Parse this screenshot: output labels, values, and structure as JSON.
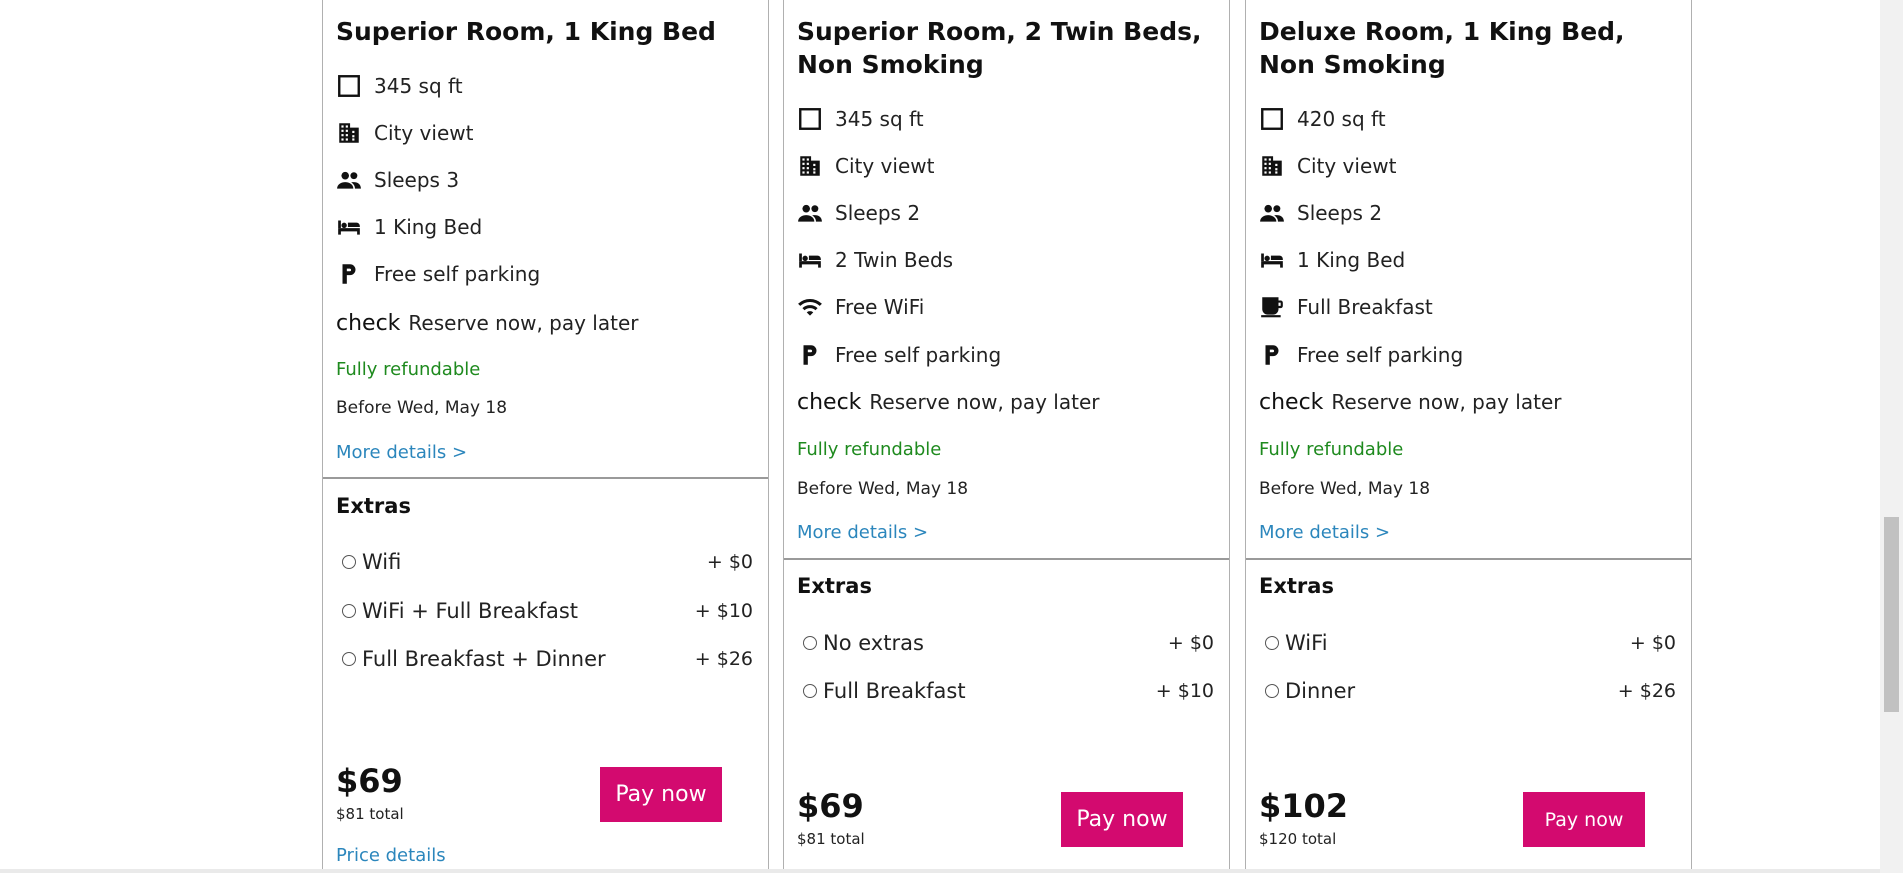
{
  "rooms": [
    {
      "title": "Superior Room, 1 King Bed",
      "features": [
        {
          "icon": "square-icon",
          "text": "345 sq ft"
        },
        {
          "icon": "building-icon",
          "text": "City viewt"
        },
        {
          "icon": "people-icon",
          "text": "Sleeps 3"
        },
        {
          "icon": "bed-icon",
          "text": "1 King Bed"
        },
        {
          "icon": "parking-icon",
          "text": "Free self parking"
        }
      ],
      "check_word": "check",
      "reserve": "Reserve now, pay later",
      "refundable": "Fully refundable",
      "before": "Before Wed, May 18",
      "more": "More details >",
      "extras_title": "Extras",
      "extras": [
        {
          "label": "Wifi",
          "price": "+ $0"
        },
        {
          "label": "WiFi + Full Breakfast",
          "price": "+ $10"
        },
        {
          "label": "Full Breakfast + Dinner",
          "price": "+ $26"
        }
      ],
      "price": "$69",
      "total": "$81 total",
      "pay": "Pay now",
      "price_details": "Price details"
    },
    {
      "title": "Superior Room, 2 Twin Beds, Non Smoking",
      "features": [
        {
          "icon": "square-icon",
          "text": "345 sq ft"
        },
        {
          "icon": "building-icon",
          "text": "City viewt"
        },
        {
          "icon": "people-icon",
          "text": "Sleeps 2"
        },
        {
          "icon": "bed-icon",
          "text": "2 Twin Beds"
        },
        {
          "icon": "wifi-icon",
          "text": "Free WiFi"
        },
        {
          "icon": "parking-icon",
          "text": "Free self parking"
        }
      ],
      "check_word": "check",
      "reserve": "Reserve now, pay later",
      "refundable": "Fully refundable",
      "before": "Before Wed, May 18",
      "more": "More details >",
      "extras_title": "Extras",
      "extras": [
        {
          "label": "No extras",
          "price": "+ $0"
        },
        {
          "label": "Full Breakfast",
          "price": "+ $10"
        }
      ],
      "price": "$69",
      "total": "$81 total",
      "pay": "Pay now"
    },
    {
      "title": "Deluxe Room, 1 King Bed, Non Smoking",
      "features": [
        {
          "icon": "square-icon",
          "text": "420 sq ft"
        },
        {
          "icon": "building-icon",
          "text": "City viewt"
        },
        {
          "icon": "people-icon",
          "text": "Sleeps 2"
        },
        {
          "icon": "bed-icon",
          "text": "1 King Bed"
        },
        {
          "icon": "coffee-icon",
          "text": "Full Breakfast"
        },
        {
          "icon": "parking-icon",
          "text": "Free self parking"
        }
      ],
      "check_word": "check",
      "reserve": "Reserve now, pay later",
      "refundable": "Fully refundable",
      "before": "Before Wed, May 18",
      "more": "More details >",
      "extras_title": "Extras",
      "extras": [
        {
          "label": "WiFi",
          "price": "+ $0"
        },
        {
          "label": " Dinner",
          "price": "+ $26"
        }
      ],
      "price": "$102",
      "total": "$120 total",
      "pay": "Pay now"
    }
  ],
  "colors": {
    "pay_button": "#d30a6f",
    "link": "#2b86bc",
    "refundable": "#1e8a1e"
  }
}
